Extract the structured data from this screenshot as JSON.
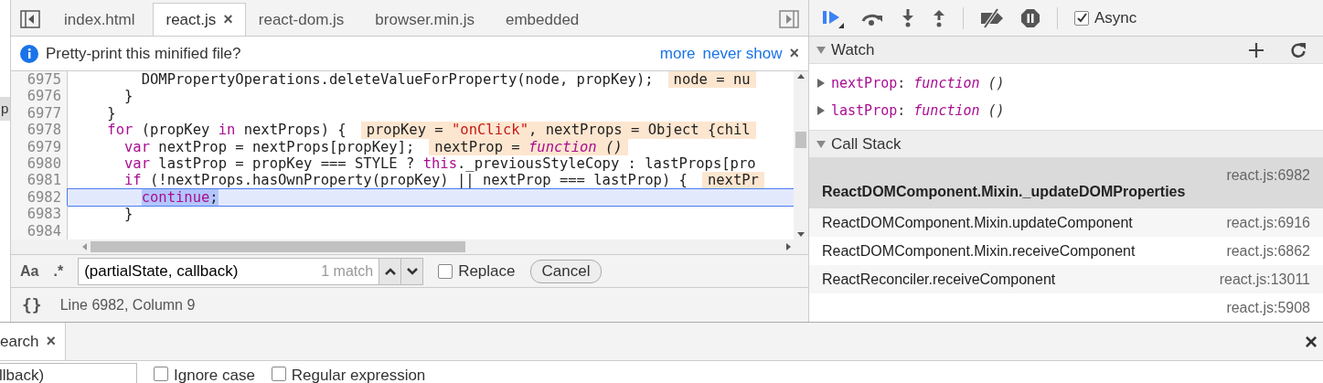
{
  "side_strip": {
    "label": "p"
  },
  "tabs": [
    {
      "label": "index.html",
      "selected": false,
      "closable": false
    },
    {
      "label": "react.js",
      "selected": true,
      "closable": true,
      "close": "×"
    },
    {
      "label": "react-dom.js",
      "selected": false,
      "closable": false
    },
    {
      "label": "browser.min.js",
      "selected": false,
      "closable": false
    },
    {
      "label": "embedded",
      "selected": false,
      "closable": false
    }
  ],
  "infobar": {
    "message": "Pretty-print this minified file?",
    "actions": [
      "more",
      "never show"
    ],
    "close": "×"
  },
  "code_lines": [
    {
      "number": "6975",
      "current": false,
      "segments": [
        {
          "text": "        DOMPropertyOperations.deleteValueForProperty(node, propKey);",
          "kind": "plain",
          "selected": false
        }
      ],
      "annotation": [
        {
          "text": "node = nu",
          "kind": "plain"
        }
      ]
    },
    {
      "number": "6976",
      "current": false,
      "segments": [
        {
          "text": "      }",
          "kind": "plain",
          "selected": false
        }
      ]
    },
    {
      "number": "6977",
      "current": false,
      "segments": [
        {
          "text": "    }",
          "kind": "plain",
          "selected": false
        }
      ]
    },
    {
      "number": "6978",
      "current": false,
      "segments": [
        {
          "text": "    for",
          "kind": "keyword",
          "selected": false
        },
        {
          "text": " (propKey ",
          "kind": "plain",
          "selected": false
        },
        {
          "text": "in",
          "kind": "keyword",
          "selected": false
        },
        {
          "text": " nextProps) {",
          "kind": "plain",
          "selected": false
        }
      ],
      "annotation": [
        {
          "text": "propKey = ",
          "kind": "plain"
        },
        {
          "text": "\"onClick\"",
          "kind": "string"
        },
        {
          "text": ", nextProps = Object {chil",
          "kind": "plain"
        }
      ]
    },
    {
      "number": "6979",
      "current": false,
      "segments": [
        {
          "text": "      var",
          "kind": "keyword",
          "selected": false
        },
        {
          "text": " nextProp = nextProps[propKey];",
          "kind": "plain",
          "selected": false
        }
      ],
      "annotation": [
        {
          "text": "nextProp = ",
          "kind": "plain"
        },
        {
          "text": "function",
          "kind": "function"
        },
        {
          "text": " ()",
          "kind": "parens"
        }
      ]
    },
    {
      "number": "6980",
      "current": false,
      "segments": [
        {
          "text": "      var",
          "kind": "keyword",
          "selected": false
        },
        {
          "text": " lastProp = propKey === STYLE ? ",
          "kind": "plain",
          "selected": false
        },
        {
          "text": "this",
          "kind": "keyword",
          "selected": false
        },
        {
          "text": "._previousStyleCopy : lastProps[pro",
          "kind": "plain",
          "selected": false
        }
      ]
    },
    {
      "number": "6981",
      "current": false,
      "segments": [
        {
          "text": "      if",
          "kind": "keyword",
          "selected": false
        },
        {
          "text": " (!nextProps.hasOwnProperty(propKey) || nextProp === lastProp) {",
          "kind": "plain",
          "selected": false
        }
      ],
      "annotation": [
        {
          "text": "nextPr",
          "kind": "plain"
        }
      ]
    },
    {
      "number": "6982",
      "current": true,
      "segments": [
        {
          "text": "        continue",
          "kind": "keyword",
          "selected": true
        },
        {
          "text": ";",
          "kind": "plain",
          "selected": true
        }
      ]
    },
    {
      "number": "6983",
      "current": false,
      "segments": [
        {
          "text": "      }",
          "kind": "plain",
          "selected": false
        }
      ]
    },
    {
      "number": "6984",
      "current": false
    }
  ],
  "find_bar": {
    "case_toggle": "Aa",
    "regex_toggle": ".*",
    "query": "(partialState, callback)",
    "matches": "1 match",
    "replace": {
      "label": "Replace",
      "checked": false
    },
    "cancel": "Cancel"
  },
  "status_bar": {
    "pretty_print": "{}",
    "position": "Line 6982, Column 9"
  },
  "debugger_toolbar": {
    "async": {
      "label": "Async",
      "checked": true
    }
  },
  "watch": {
    "title": "Watch",
    "expanded": true,
    "items": [
      {
        "name": "nextProp",
        "separator": ":",
        "value": "function",
        "suffix": "()",
        "expanded": false
      },
      {
        "name": "lastProp",
        "separator": ":",
        "value": "function",
        "suffix": "()",
        "expanded": false
      }
    ]
  },
  "call_stack": {
    "title": "Call Stack",
    "expanded": true,
    "frames": [
      {
        "name": "ReactDOMComponent.Mixin._updateDOMProperties",
        "location": "react.js:6982",
        "selected": true
      },
      {
        "name": "ReactDOMComponent.Mixin.updateComponent",
        "location": "react.js:6916",
        "selected": false
      },
      {
        "name": "ReactDOMComponent.Mixin.receiveComponent",
        "location": "react.js:6862",
        "selected": false
      },
      {
        "name": "ReactReconciler.receiveComponent",
        "location": "react.js:13011",
        "selected": false
      },
      {
        "location": "react.js:5908",
        "selected": false
      }
    ]
  },
  "drawer": {
    "tabs": [
      {
        "label": "earch",
        "selected": true,
        "close": "×"
      }
    ],
    "close": "×",
    "query": "llback)",
    "options": [
      {
        "label": "Ignore case",
        "checked": false
      },
      {
        "label": "Regular expression",
        "checked": false
      }
    ]
  }
}
